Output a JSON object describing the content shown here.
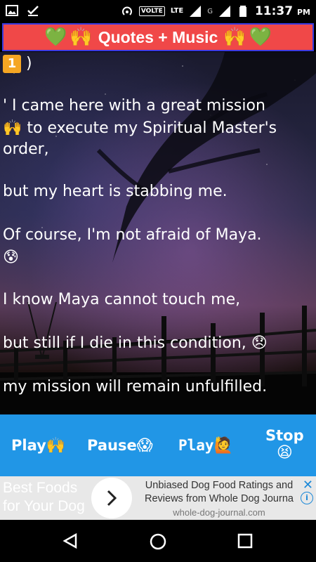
{
  "status_bar": {
    "time": "11:37",
    "ampm": "PM",
    "volte": "VOLTE",
    "lte": "LTE",
    "g": "G"
  },
  "title": {
    "text": "Quotes + Music",
    "emoji_heart": "💚",
    "emoji_hands": "🙌"
  },
  "quote": {
    "badge": "1",
    "badge_suffix": ")",
    "lines": [
      "' I came here with a great mission",
      "to execute my Spiritual Master's",
      "order,",
      "but my heart is stabbing me.",
      "Of course, I'm not afraid of Maya.",
      "I know Maya cannot touch me,",
      "but still if I die in this condition,",
      "my mission will remain unfulfilled."
    ],
    "emoji_hands": "🙌",
    "emoji_fear": "😰",
    "emoji_sad": "😞"
  },
  "controls": {
    "play1": "Play",
    "play1_emoji": "🙌",
    "pause": "Pause",
    "pause_emoji": "😱",
    "play2": "Play",
    "play2_emoji": "🙋",
    "stop": "Stop",
    "stop_emoji": "😫"
  },
  "ad": {
    "left_line1": "Best Foods",
    "left_line2": "for Your Dog",
    "right_line1": "Unbiased Dog Food Ratings and",
    "right_line2": "Reviews from Whole Dog Journa",
    "domain": "whole-dog-journal.com"
  }
}
